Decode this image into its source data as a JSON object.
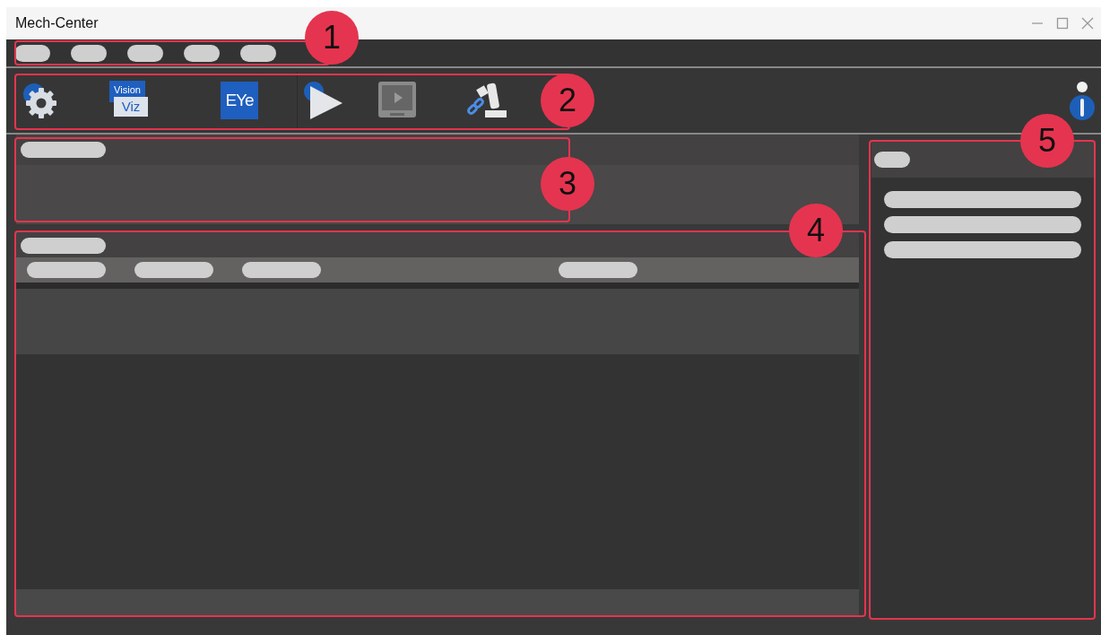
{
  "window": {
    "title": "Mech-Center"
  },
  "toolbar": [
    {
      "kind": "gear"
    },
    {
      "kind": "vision-viz",
      "top": "Vision",
      "bottom": "Viz"
    },
    {
      "kind": "eye",
      "label": "EYe"
    },
    {
      "kind": "play"
    },
    {
      "kind": "monitor"
    },
    {
      "kind": "robot"
    }
  ],
  "callouts": [
    "1",
    "2",
    "3",
    "4",
    "5"
  ]
}
